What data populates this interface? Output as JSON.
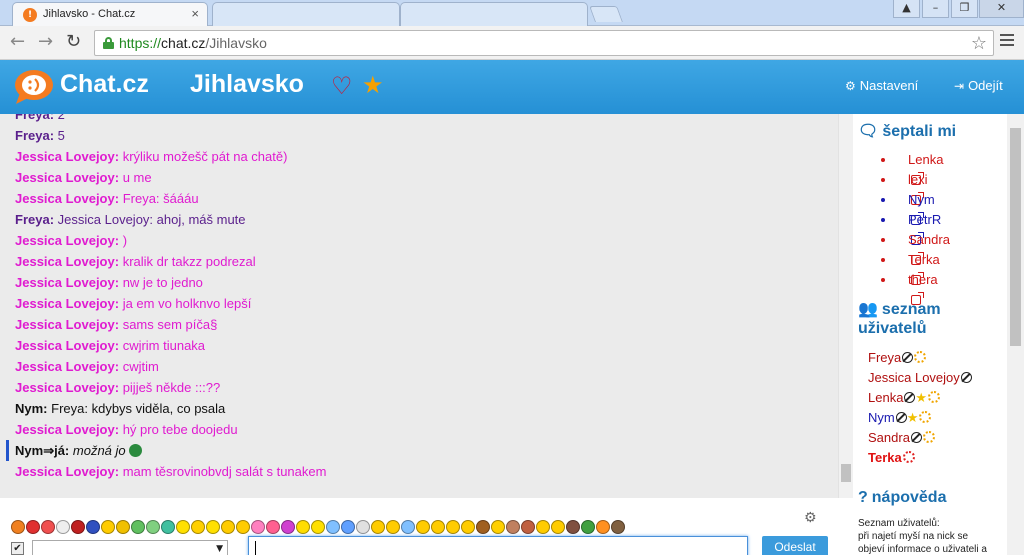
{
  "browser": {
    "tab_title": "Jihlavsko - Chat.cz",
    "url_scheme": "https://",
    "url_host": "chat.cz",
    "url_path": "/Jihlavsko"
  },
  "header": {
    "logo": "Chat.cz",
    "room": "Jihlavsko",
    "settings_label": "Nastavení",
    "logout_label": "Odejít",
    "colors": {
      "header_bg": "#2b97db",
      "heart": "#d0112b",
      "star": "#f5a000"
    }
  },
  "chat": {
    "messages": [
      {
        "nick": "Freya:",
        "text": "2",
        "color": "#5a1f8c"
      },
      {
        "nick": "Freya:",
        "text": "5",
        "color": "#5a1f8c"
      },
      {
        "nick": "Jessica Lovejoy:",
        "text": "krýliku možešč pát na chatě)",
        "color": "#e01bd0"
      },
      {
        "nick": "Jessica Lovejoy:",
        "text": "u me",
        "color": "#e01bd0"
      },
      {
        "nick": "Jessica Lovejoy:",
        "text": "Freya: šáááu",
        "color": "#e01bd0"
      },
      {
        "nick": "Freya:",
        "text": "Jessica Lovejoy: ahoj, máš mute",
        "color": "#5a1f8c"
      },
      {
        "nick": "Jessica Lovejoy:",
        "text": ")",
        "color": "#e01bd0"
      },
      {
        "nick": "Jessica Lovejoy:",
        "text": "kralik dr takzz podrezal",
        "color": "#e01bd0"
      },
      {
        "nick": "Jessica Lovejoy:",
        "text": "nw je to jedno",
        "color": "#e01bd0"
      },
      {
        "nick": "Jessica Lovejoy:",
        "text": "ja em vo holknvo lepší",
        "color": "#e01bd0"
      },
      {
        "nick": "Jessica Lovejoy:",
        "text": "sams sem píča§",
        "color": "#e01bd0"
      },
      {
        "nick": "Jessica Lovejoy:",
        "text": "cwjrim tiunaka",
        "color": "#e01bd0"
      },
      {
        "nick": "Jessica Lovejoy:",
        "text": "cwjtim",
        "color": "#e01bd0"
      },
      {
        "nick": "Jessica Lovejoy:",
        "text": "pijješ někde :::??",
        "color": "#e01bd0"
      },
      {
        "nick": "Nym:",
        "text": "Freya: kdybys viděla, co psala",
        "color": "#111111"
      },
      {
        "nick": "Jessica Lovejoy:",
        "text": "hý pro tebe doojedu",
        "color": "#e01bd0"
      },
      {
        "nick": "Nym",
        "arrow": "⇒",
        "to": "já:",
        "text": "možná jo",
        "color": "#111111",
        "private": true
      },
      {
        "nick": "Jessica Lovejoy:",
        "text": "mam těsrovinobvdj salát s tunakem",
        "color": "#e01bd0"
      }
    ]
  },
  "sidebar": {
    "whispers_title": "šeptali mi",
    "whispers": [
      {
        "name": "Lenka",
        "color": "#d01818"
      },
      {
        "name": "lexi",
        "color": "#d01818"
      },
      {
        "name": "Nym",
        "color": "#1a1ab0"
      },
      {
        "name": "PetrR",
        "color": "#1a1ab0"
      },
      {
        "name": "Sandra",
        "color": "#d01818"
      },
      {
        "name": "Terka",
        "color": "#d01818"
      },
      {
        "name": "thera",
        "color": "#d01818"
      }
    ],
    "users_title_line1": "seznam",
    "users_title_line2": "uživatelů",
    "users": [
      {
        "name": "Freya",
        "color": "#b01010",
        "icons": [
          "ban",
          "sun"
        ]
      },
      {
        "name": "Jessica Lovejoy",
        "color": "#b01010",
        "icons": [
          "ban"
        ]
      },
      {
        "name": "Lenka",
        "color": "#b01010",
        "icons": [
          "ban",
          "star",
          "sun"
        ]
      },
      {
        "name": "Nym",
        "color": "#1a1ab0",
        "icons": [
          "ban",
          "star",
          "sun"
        ]
      },
      {
        "name": "Sandra",
        "color": "#b01010",
        "icons": [
          "ban",
          "sun"
        ]
      },
      {
        "name": "Terka",
        "color": "#e01010",
        "icons": [
          "sun-red"
        ],
        "bold": true
      }
    ],
    "help_title": "nápověda",
    "help_line1": "Seznam uživatelů:",
    "help_line2": "při najetí myší na nick se",
    "help_line3": "objeví informace o uživateli a"
  },
  "input": {
    "send_label": "Odeslat",
    "checkbox": "✔",
    "select_arrow": "▼",
    "emoticon_colors": [
      "#f08020",
      "#e03030",
      "#f05050",
      "#eeeeee",
      "#c02020",
      "#3050c0",
      "#ffcc00",
      "#f0c000",
      "#60c060",
      "#80d080",
      "#40c0a0",
      "#ffe000",
      "#ffd000",
      "#ffe000",
      "#ffcc00",
      "#ffcc00",
      "#ff80c0",
      "#ff6090",
      "#d040d0",
      "#ffdd00",
      "#ffe000",
      "#80c0ff",
      "#60a0ff",
      "#e0e0e0",
      "#ffcc00",
      "#ffcc00",
      "#80c0ff",
      "#ffcc00",
      "#ffcc00",
      "#ffcc00",
      "#ffcc00",
      "#a06020",
      "#ffd000",
      "#c08060",
      "#c06040",
      "#ffcc00",
      "#ffcc00",
      "#805040",
      "#40a040",
      "#ff9020",
      "#806040"
    ]
  }
}
